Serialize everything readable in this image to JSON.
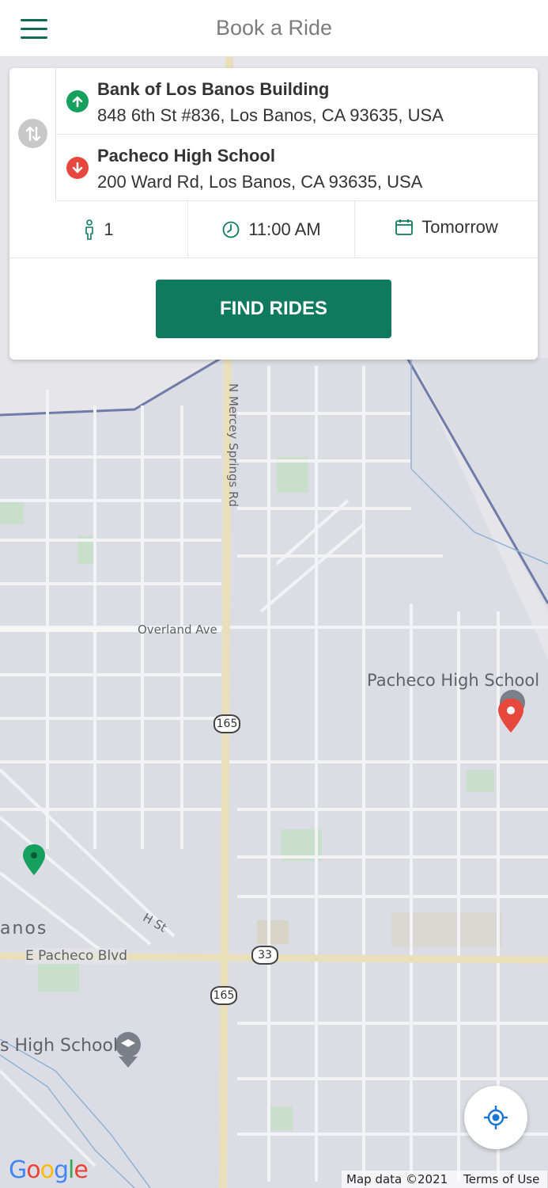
{
  "header": {
    "title": "Book a Ride",
    "menu_icon": "hamburger-menu-icon"
  },
  "trip": {
    "pickup": {
      "name": "Bank of Los Banos Building",
      "address": "848 6th St #836, Los Banos, CA 93635, USA",
      "icon": "arrow-up-icon",
      "color": "#16a05d"
    },
    "dropoff": {
      "name": "Pacheco High School",
      "address": "200 Ward Rd, Los Banos, CA 93635, USA",
      "icon": "arrow-down-icon",
      "color": "#e6483d"
    },
    "swap_icon": "swap-vertical-icon"
  },
  "options": {
    "passengers": "1",
    "time": "11:00 AM",
    "date": "Tomorrow"
  },
  "actions": {
    "find_rides": "FIND RIDES"
  },
  "map": {
    "labels": {
      "road_mercey": "N Mercey Springs Rd",
      "road_overland": "Overland Ave",
      "poi_pacheco": "Pacheco High School",
      "road_h": "H St",
      "city_partial": "anos",
      "road_pacheco_blvd": "E Pacheco Blvd",
      "poi_school_partial": "s High School"
    },
    "shields": {
      "route_165_top": "165",
      "route_165_bottom": "165",
      "route_33": "33"
    },
    "markers": {
      "pickup_color": "#16a05d",
      "dropoff_color": "#e6483d"
    },
    "logo": "Google",
    "attribution": {
      "map_data": "Map data ©2021",
      "terms": "Terms of Use"
    }
  },
  "colors": {
    "brand": "#0f7a5e",
    "map_bg": "#dfe0e6"
  }
}
